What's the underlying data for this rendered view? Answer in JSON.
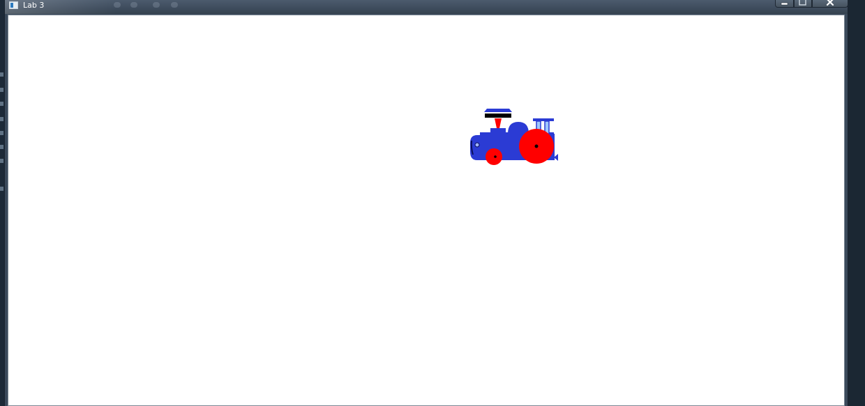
{
  "window": {
    "title": "Lab 3",
    "controls": {
      "minimize": "minimize-icon",
      "maximize": "maximize-icon",
      "close": "close-icon"
    }
  },
  "scene": {
    "object": "train",
    "colors": {
      "body": "#2b3bd4",
      "wheel": "#ff0000",
      "hub": "#000000",
      "funnel_top": "#2b3bd4",
      "funnel_band": "#000000",
      "funnel_neck": "#ff0000",
      "cab_window": "#2b3bd4",
      "background": "#ffffff"
    }
  }
}
